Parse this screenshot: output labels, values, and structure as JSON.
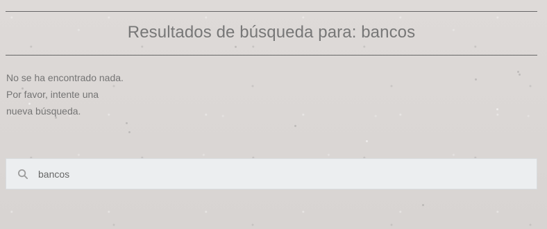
{
  "page": {
    "title": "Resultados de búsqueda para: bancos",
    "no_results_message": "No se ha encontrado nada. Por favor, intente una nueva búsqueda."
  },
  "search": {
    "value": "bancos",
    "placeholder": "",
    "icon": "search-icon"
  }
}
